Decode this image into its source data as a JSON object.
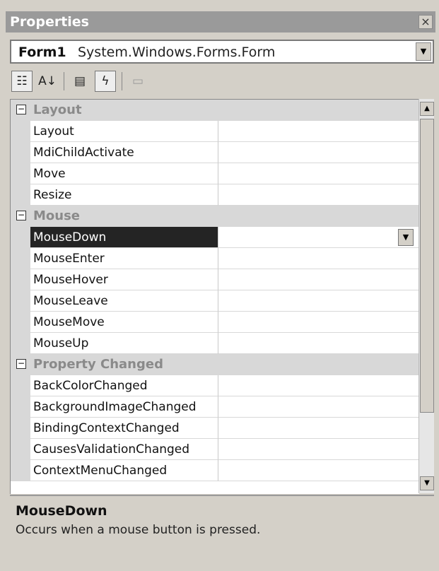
{
  "window": {
    "title": "Properties",
    "close_glyph": "×"
  },
  "object_selector": {
    "name": "Form1",
    "type": "System.Windows.Forms.Form"
  },
  "toolbar": {
    "buttons": [
      {
        "icon": "categorized-icon",
        "glyph": "☷"
      },
      {
        "icon": "alphabetical-icon",
        "glyph": "A↓"
      },
      {
        "icon": "properties-icon",
        "glyph": "▤"
      },
      {
        "icon": "events-icon",
        "glyph": "ϟ"
      },
      {
        "icon": "property-pages-icon",
        "glyph": "▭"
      }
    ]
  },
  "grid": {
    "collapse_glyph": "−",
    "dropdown_glyph": "▼",
    "categories": [
      {
        "label": "Layout",
        "events": [
          "Layout",
          "MdiChildActivate",
          "Move",
          "Resize"
        ]
      },
      {
        "label": "Mouse",
        "events": [
          "MouseDown",
          "MouseEnter",
          "MouseHover",
          "MouseLeave",
          "MouseMove",
          "MouseUp"
        ]
      },
      {
        "label": "Property Changed",
        "events": [
          "BackColorChanged",
          "BackgroundImageChanged",
          "BindingContextChanged",
          "CausesValidationChanged",
          "ContextMenuChanged"
        ]
      }
    ],
    "selected_event": "MouseDown"
  },
  "scrollbar": {
    "up_glyph": "▲",
    "down_glyph": "▼"
  },
  "description": {
    "title": "MouseDown",
    "text": "Occurs when a mouse button is pressed."
  }
}
